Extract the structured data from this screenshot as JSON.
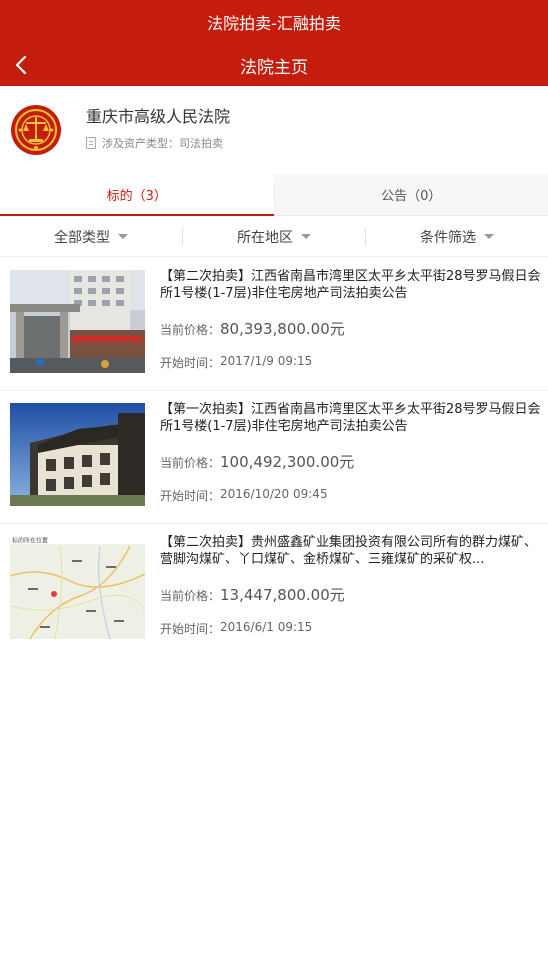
{
  "status_bar": {
    "title": "法院拍卖-汇融拍卖"
  },
  "nav": {
    "title": "法院主页",
    "back_icon": "chevron-left-icon"
  },
  "court": {
    "name": "重庆市高级人民法院",
    "asset_type_label": "涉及资产类型：",
    "asset_type_value": "司法拍卖"
  },
  "tabs": [
    {
      "label": "标的（3）",
      "active": true
    },
    {
      "label": "公告（0）",
      "active": false
    }
  ],
  "filters": [
    {
      "label": "全部类型"
    },
    {
      "label": "所在地区"
    },
    {
      "label": "条件筛选"
    }
  ],
  "items": [
    {
      "title": "【第二次拍卖】江西省南昌市湾里区太平乡太平街28号罗马假日会所1号楼(1-7层)非住宅房地产司法拍卖公告",
      "price_label": "当前价格：",
      "price": "80,393,800.00元",
      "time_label": "开始时间：",
      "time": "2017/1/9 09:15"
    },
    {
      "title": "【第一次拍卖】江西省南昌市湾里区太平乡太平街28号罗马假日会所1号楼(1-7层)非住宅房地产司法拍卖公告",
      "price_label": "当前价格：",
      "price": "100,492,300.00元",
      "time_label": "开始时间：",
      "time": "2016/10/20 09:45"
    },
    {
      "title": "【第二次拍卖】贵州盛鑫矿业集团投资有限公司所有的群力煤矿、营脚沟煤矿、丫口煤矿、金桥煤矿、三雍煤矿的采矿权...",
      "price_label": "当前价格：",
      "price": "13,447,800.00元",
      "time_label": "开始时间：",
      "time": "2016/6/1 09:15",
      "map_caption": "标的所在位置"
    }
  ],
  "colors": {
    "brand_red": "#c51d0d",
    "tab_bg": "#f7f7f7"
  }
}
